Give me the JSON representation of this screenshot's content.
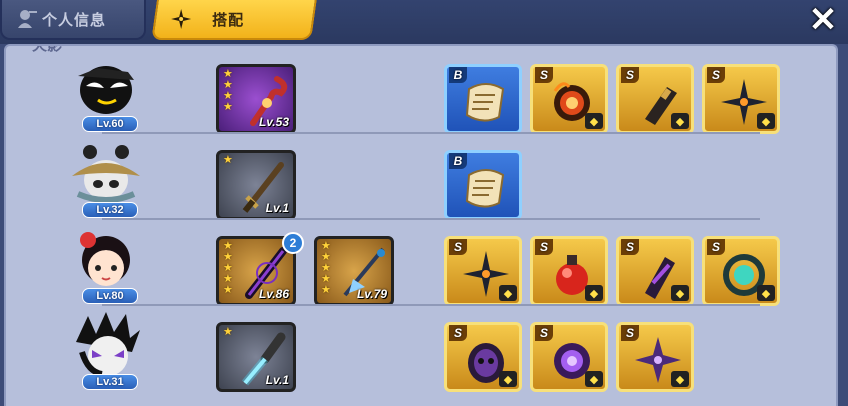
{
  "tabs": {
    "info_label": "个人信息",
    "match_label": "搭配"
  },
  "panel": {
    "header_text": "火影"
  },
  "rows": [
    {
      "character": "black-ninja",
      "level": "Lv.60",
      "weapons": [
        {
          "stars": 4,
          "level": "Lv.53",
          "frame": "purple",
          "icon": "crimson-staff-icon"
        }
      ],
      "items": [
        {
          "grade": "B",
          "frame": "blue",
          "icon": "scroll-icon"
        },
        {
          "grade": "S",
          "frame": "gold",
          "icon": "fire-ring-icon"
        },
        {
          "grade": "S",
          "frame": "gold",
          "icon": "gauntlet-icon"
        },
        {
          "grade": "S",
          "frame": "gold",
          "icon": "shuriken-icon"
        }
      ]
    },
    {
      "character": "panda-hat-ninja",
      "level": "Lv.32",
      "weapons": [
        {
          "stars": 1,
          "level": "Lv.1",
          "frame": "gray",
          "icon": "sword-icon"
        }
      ],
      "items": [
        {
          "grade": "B",
          "frame": "blue",
          "icon": "scroll-icon"
        }
      ]
    },
    {
      "character": "red-hair-girl",
      "level": "Lv.80",
      "weapons": [
        {
          "stars": 5,
          "level": "Lv.86",
          "frame": "gold",
          "icon": "dark-blade-icon",
          "badge": "2"
        },
        {
          "stars": 5,
          "level": "Lv.79",
          "frame": "gold",
          "icon": "spear-icon"
        }
      ],
      "items": [
        {
          "grade": "S",
          "frame": "gold",
          "icon": "shuriken-icon"
        },
        {
          "grade": "S",
          "frame": "gold",
          "icon": "red-potion-icon"
        },
        {
          "grade": "S",
          "frame": "gold",
          "icon": "bracer-icon"
        },
        {
          "grade": "S",
          "frame": "gold",
          "icon": "jade-ring-icon"
        }
      ]
    },
    {
      "character": "spiky-hair-ninja",
      "level": "Lv.31",
      "weapons": [
        {
          "stars": 1,
          "level": "Lv.1",
          "frame": "gray",
          "icon": "light-saber-icon"
        }
      ],
      "items": [
        {
          "grade": "S",
          "frame": "gold",
          "icon": "daruma-icon"
        },
        {
          "grade": "S",
          "frame": "gold",
          "icon": "purple-ring-icon"
        },
        {
          "grade": "S",
          "frame": "gold",
          "icon": "star-shuriken-icon"
        }
      ]
    }
  ]
}
